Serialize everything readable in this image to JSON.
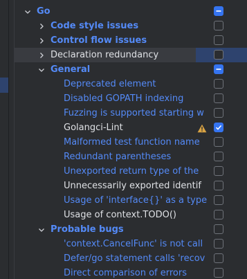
{
  "tree": {
    "rows": [
      {
        "label": "Go",
        "style": "cat",
        "chevron": "down",
        "checkbox": "partial"
      },
      {
        "label": "Code style issues",
        "style": "cat",
        "chevron": "right",
        "checkbox": "empty"
      },
      {
        "label": "Control flow issues",
        "style": "cat",
        "chevron": "right",
        "checkbox": "empty"
      },
      {
        "label": "Declaration redundancy",
        "style": "white",
        "chevron": "right",
        "checkbox": "empty",
        "selected": true
      },
      {
        "label": "General",
        "style": "cat",
        "chevron": "down",
        "checkbox": "partial"
      },
      {
        "label": "Deprecated element",
        "style": "blue",
        "checkbox": "empty"
      },
      {
        "label": "Disabled GOPATH indexing",
        "style": "blue",
        "checkbox": "empty"
      },
      {
        "label": "Fuzzing is supported starting w",
        "style": "blue",
        "checkbox": "empty"
      },
      {
        "label": "Golangci-Lint",
        "style": "white",
        "checkbox": "checked",
        "warning": true
      },
      {
        "label": "Malformed test function name",
        "style": "blue",
        "checkbox": "empty"
      },
      {
        "label": "Redundant parentheses",
        "style": "blue",
        "checkbox": "empty"
      },
      {
        "label": "Unexported return type of the",
        "style": "blue",
        "checkbox": "empty"
      },
      {
        "label": "Unnecessarily exported identif",
        "style": "white",
        "checkbox": "empty"
      },
      {
        "label": "Usage of 'interface{}' as a type",
        "style": "blue",
        "checkbox": "empty"
      },
      {
        "label": "Usage of context.TODO()",
        "style": "white",
        "checkbox": "empty"
      },
      {
        "label": "Probable bugs",
        "style": "cat",
        "chevron": "down",
        "checkbox": "empty"
      },
      {
        "label": "'context.CancelFunc' is not call",
        "style": "blue",
        "checkbox": "empty"
      },
      {
        "label": "Defer/go statement calls 'recov",
        "style": "blue",
        "checkbox": "empty"
      },
      {
        "label": "Direct comparison of errors",
        "style": "blue",
        "checkbox": "empty"
      }
    ]
  },
  "colors": {
    "background": "#2b2d30",
    "category_blue": "#548af7",
    "text_white": "#dfe1e5",
    "checkbox_blue": "#3574f0",
    "warning_yellow": "#d9a343",
    "selection": "#2e436e"
  },
  "icons": {
    "expand": "chevron-down-icon",
    "collapse": "chevron-right-icon",
    "warning": "warning-triangle-icon",
    "check": "checkmark-icon"
  }
}
